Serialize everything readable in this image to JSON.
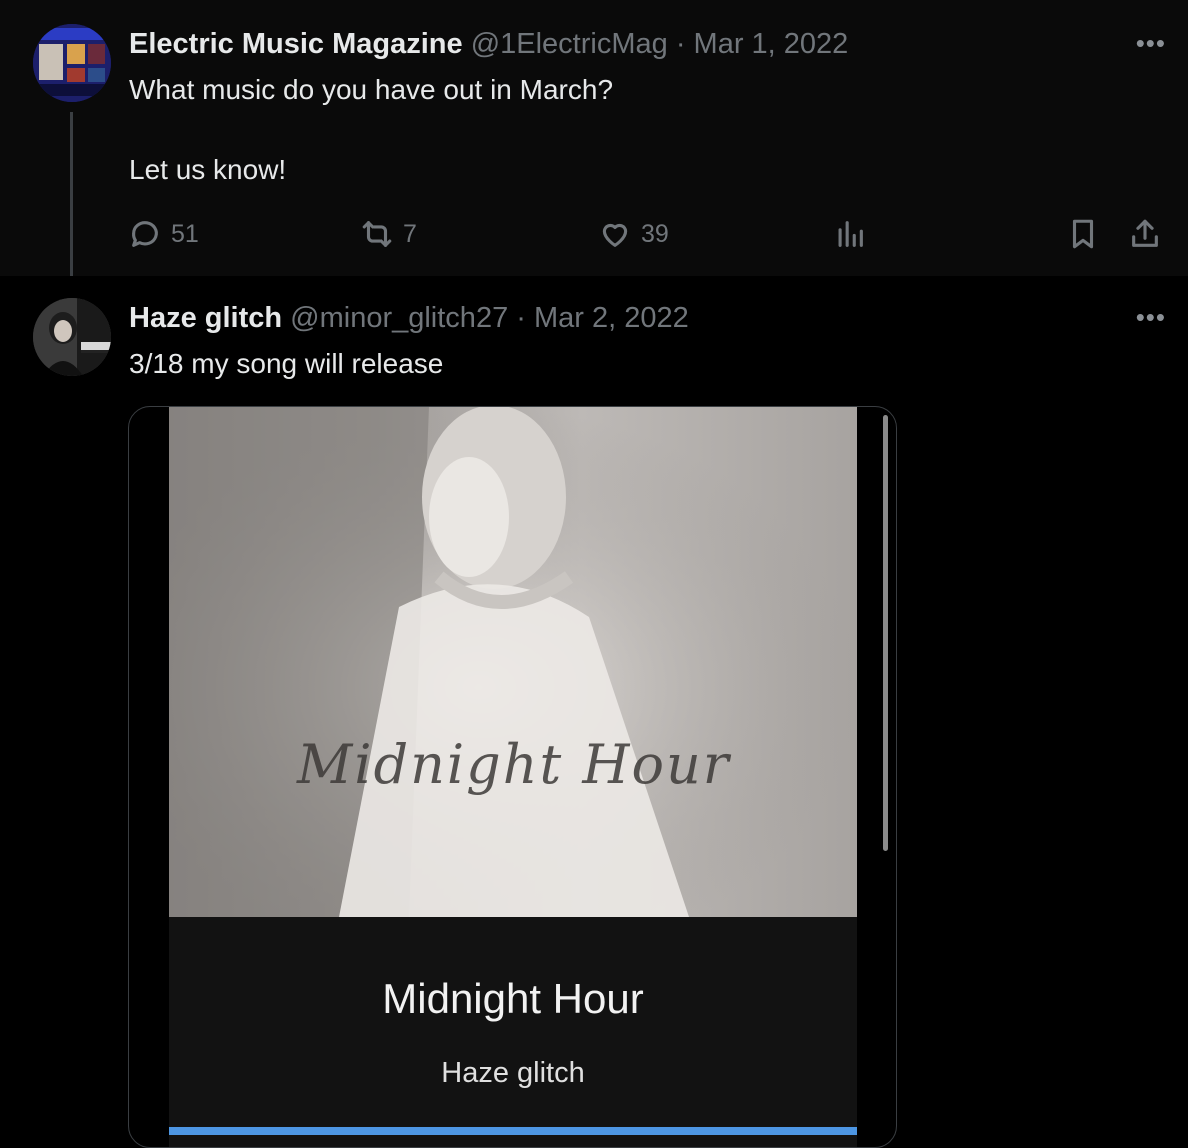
{
  "tweets": [
    {
      "author_name": "Electric Music Magazine",
      "handle": "@1ElectricMag",
      "separator": "·",
      "date": "Mar 1, 2022",
      "lines": [
        "What music do you have out in March?",
        "Let us know!"
      ],
      "more": "•••",
      "actions": {
        "replies": "51",
        "reposts": "7",
        "likes": "39"
      }
    },
    {
      "author_name": "Haze glitch",
      "handle": "@minor_glitch27",
      "separator": "·",
      "date": "Mar 2, 2022",
      "lines": [
        "3/18 my song will release"
      ],
      "more": "•••",
      "media": {
        "cover_script_text": "Midnight Hour",
        "song_title": "Midnight Hour",
        "artist": "Haze glitch",
        "progress_fraction": 1.0
      }
    }
  ],
  "icons": {
    "reply": "chat-bubble-icon",
    "repost": "repost-arrows-icon",
    "like": "heart-icon",
    "views": "bar-chart-icon",
    "bookmark": "bookmark-icon",
    "share": "share-upload-icon",
    "more": "more-dots-icon"
  },
  "colors": {
    "background": "#000000",
    "muted": "#71767b",
    "text": "#e7e9ea",
    "progress": "#4d96e3"
  }
}
